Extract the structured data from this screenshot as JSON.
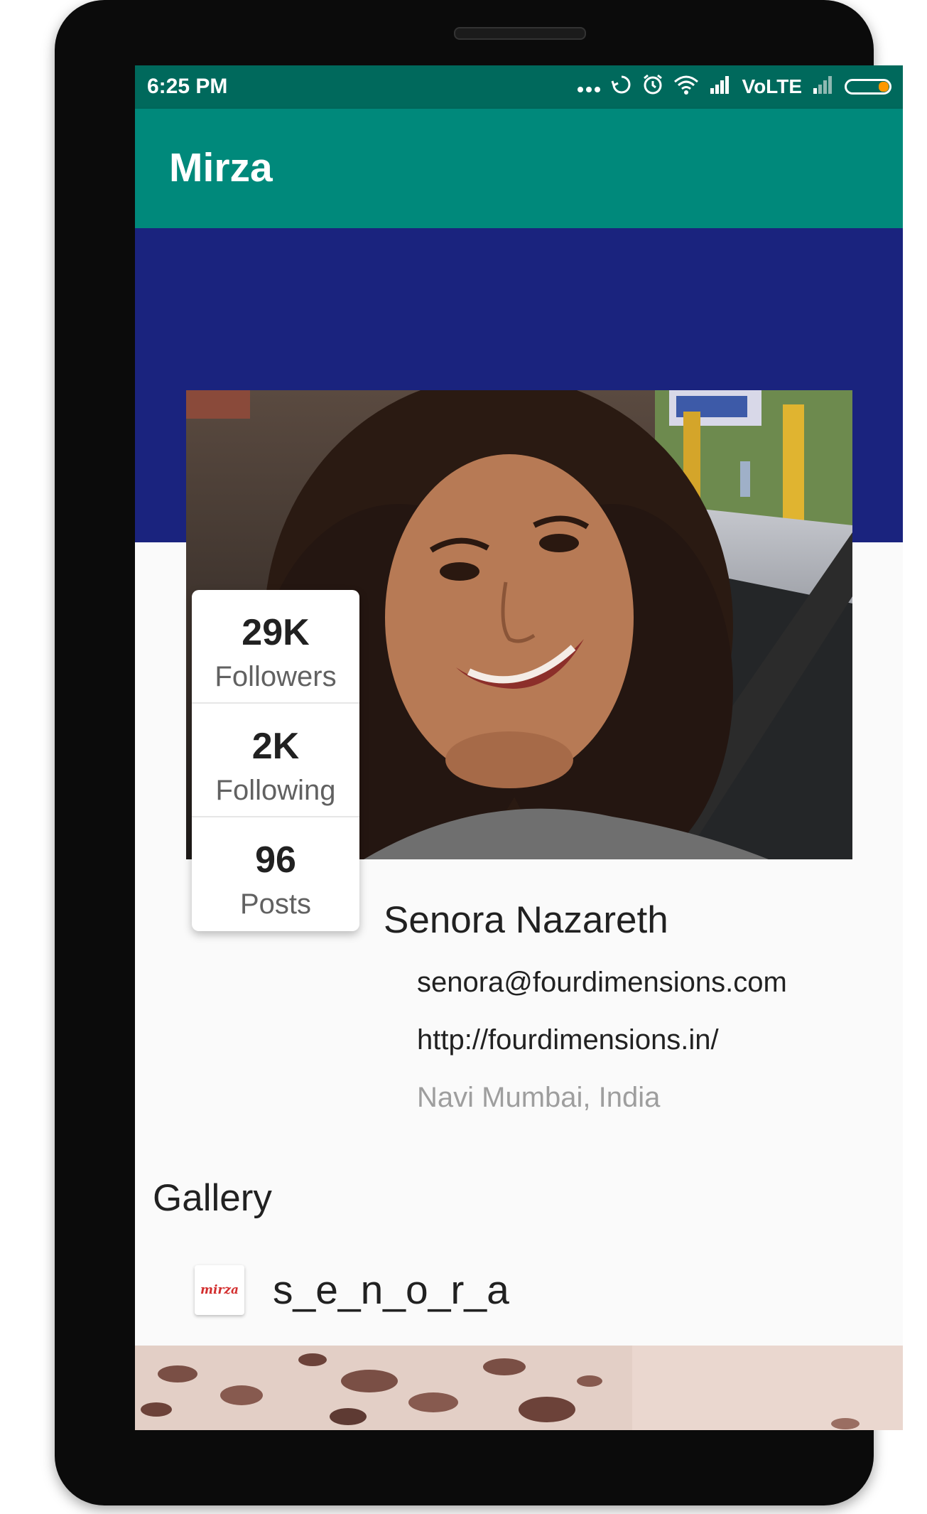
{
  "status_bar": {
    "time": "6:25 PM",
    "network_label": "VoLTE",
    "icons": [
      "more-dots-icon",
      "sync-icon",
      "alarm-icon",
      "wifi-icon",
      "signal-icon",
      "signal-weak-icon",
      "battery-icon"
    ],
    "battery_color": "#ff9800"
  },
  "app_bar": {
    "title": "Mirza",
    "color": "#00897b"
  },
  "header": {
    "band_color": "#1a237e"
  },
  "stats": [
    {
      "value": "29K",
      "label": "Followers"
    },
    {
      "value": "2K",
      "label": "Following"
    },
    {
      "value": "96",
      "label": "Posts"
    }
  ],
  "profile": {
    "name": "Senora Nazareth",
    "email": "senora@fourdimensions.com",
    "website": "http://fourdimensions.in/",
    "location": "Navi Mumbai, India"
  },
  "gallery": {
    "title": "Gallery",
    "username": "s_e_n_o_r_a",
    "avatar_text": "mirza"
  }
}
